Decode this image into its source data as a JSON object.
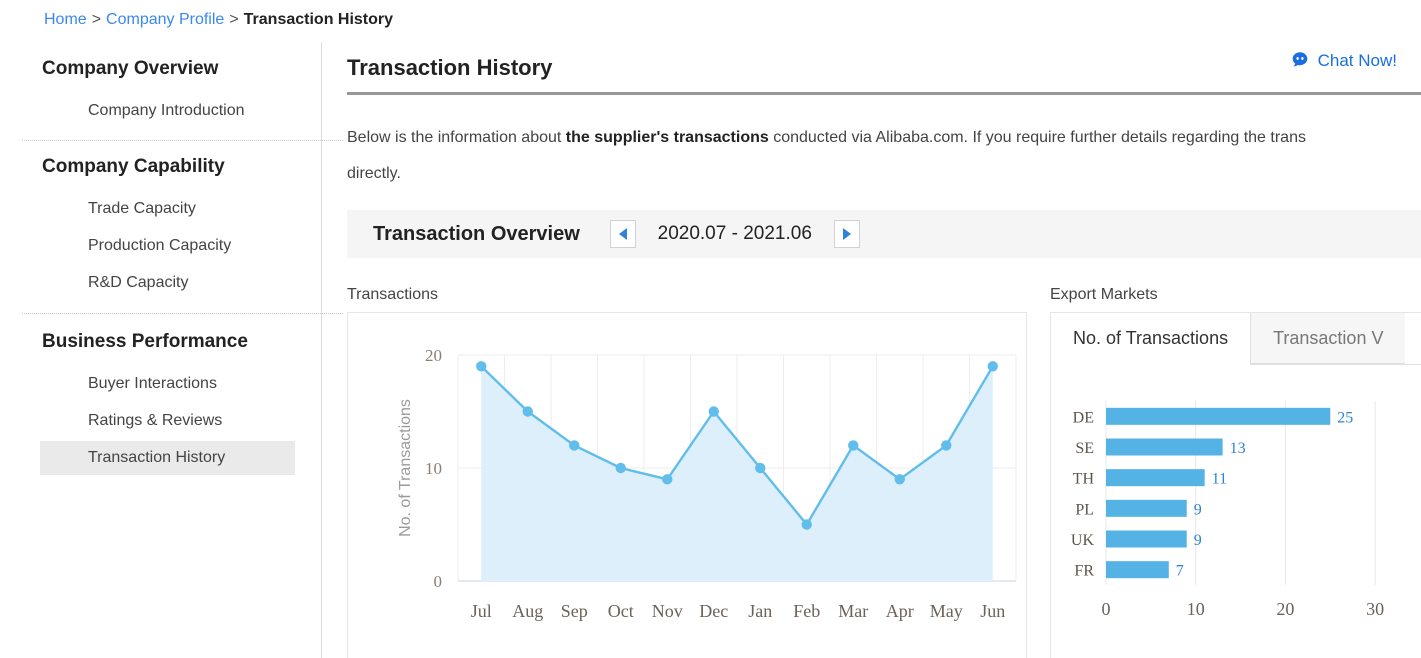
{
  "breadcrumb": {
    "items": [
      {
        "label": "Home",
        "type": "link"
      },
      {
        "label": "Company Profile",
        "type": "link"
      },
      {
        "label": "Transaction History",
        "type": "current"
      }
    ],
    "separator": ">"
  },
  "sidebar": {
    "sections": [
      {
        "title": "Company Overview",
        "items": [
          {
            "label": "Company Introduction",
            "active": false
          }
        ]
      },
      {
        "title": "Company Capability",
        "items": [
          {
            "label": "Trade Capacity",
            "active": false
          },
          {
            "label": "Production Capacity",
            "active": false
          },
          {
            "label": "R&D Capacity",
            "active": false
          }
        ]
      },
      {
        "title": "Business Performance",
        "items": [
          {
            "label": "Buyer Interactions",
            "active": false
          },
          {
            "label": "Ratings & Reviews",
            "active": false
          },
          {
            "label": "Transaction History",
            "active": true
          }
        ]
      }
    ]
  },
  "header": {
    "title": "Transaction History",
    "chat_label": "Chat Now!",
    "chat_icon": "chat-mascot-icon"
  },
  "intro": {
    "part1": "Below is the information about ",
    "bold": "the supplier's transactions",
    "part2": " conducted via Alibaba.com. If you require further details regarding the trans",
    "line2": "directly."
  },
  "overview": {
    "title": "Transaction Overview",
    "date_range": "2020.07 - 2021.06",
    "prev_icon": "chevron-left-icon",
    "next_icon": "chevron-right-icon"
  },
  "left_chart_caption": "Transactions",
  "right_chart_caption": "Export Markets",
  "tabs": [
    {
      "label": "No. of Transactions",
      "active": true
    },
    {
      "label": "Transaction V",
      "active": false
    }
  ],
  "colors": {
    "line": "#61bdea",
    "area": "#ddeffa",
    "bar": "#54b3e4",
    "bar_label": "#2f82d8",
    "accent_link": "#3b87f2",
    "grid": "#ededed",
    "axis_text": "#8a7f72"
  },
  "chart_data": [
    {
      "type": "area",
      "title": "Transactions",
      "xlabel": "",
      "ylabel": "No. of Transactions",
      "categories": [
        "Jul",
        "Aug",
        "Sep",
        "Oct",
        "Nov",
        "Dec",
        "Jan",
        "Feb",
        "Mar",
        "Apr",
        "May",
        "Jun"
      ],
      "values": [
        19,
        15,
        12,
        10,
        9,
        15,
        10,
        5,
        12,
        9,
        12,
        19
      ],
      "ylim": [
        0,
        20
      ],
      "yticks": [
        0,
        10,
        20
      ],
      "grid": true,
      "legend": "none"
    },
    {
      "type": "bar",
      "orientation": "horizontal",
      "title": "Export Markets",
      "xlabel": "",
      "ylabel": "",
      "categories": [
        "DE",
        "SE",
        "TH",
        "PL",
        "UK",
        "FR"
      ],
      "values": [
        25,
        13,
        11,
        9,
        9,
        7
      ],
      "xlim": [
        0,
        34
      ],
      "xticks": [
        0,
        10,
        20,
        30
      ],
      "data_labels": [
        "25",
        "13",
        "11",
        "9",
        "9",
        "7"
      ],
      "grid": true,
      "legend": "none"
    }
  ]
}
